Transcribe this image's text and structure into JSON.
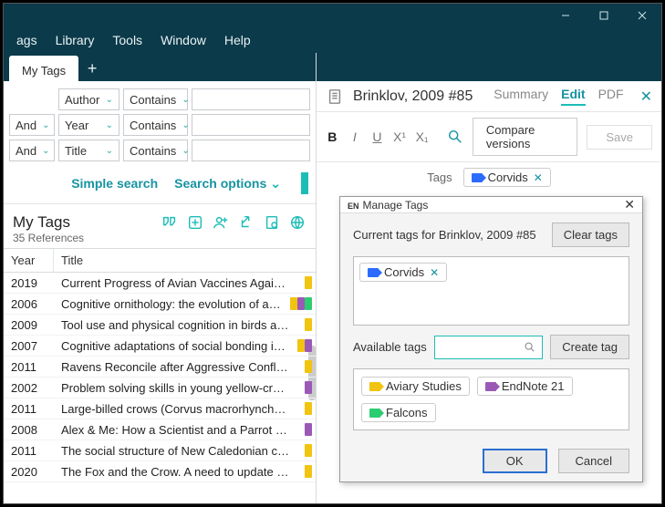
{
  "menubar": {
    "items": [
      "ags",
      "Library",
      "Tools",
      "Window",
      "Help"
    ]
  },
  "tabs": {
    "active": "My Tags"
  },
  "filters": {
    "rows": [
      {
        "op": null,
        "field": "Author",
        "cond": "Contains"
      },
      {
        "op": "And",
        "field": "Year",
        "cond": "Contains"
      },
      {
        "op": "And",
        "field": "Title",
        "cond": "Contains"
      }
    ],
    "simple": "Simple search",
    "options": "Search options"
  },
  "group": {
    "title": "My Tags",
    "subtitle": "35 References"
  },
  "columns": {
    "year": "Year",
    "title": "Title"
  },
  "rows": [
    {
      "year": "2019",
      "title": "Current Progress of Avian Vaccines Against …",
      "tags": [
        "#f1c40f"
      ]
    },
    {
      "year": "2006",
      "title": "Cognitive ornithology: the evolution of a…",
      "tags": [
        "#f1c40f",
        "#9b59b6",
        "#2ecc71"
      ]
    },
    {
      "year": "2009",
      "title": "Tool use and physical cognition in birds and…",
      "tags": [
        "#f1c40f"
      ]
    },
    {
      "year": "2007",
      "title": "Cognitive adaptations of social bonding i…",
      "tags": [
        "#f1c40f",
        "#9b59b6"
      ]
    },
    {
      "year": "2011",
      "title": "Ravens Reconcile after Aggressive Conflicts …",
      "tags": [
        "#f1c40f"
      ]
    },
    {
      "year": "2002",
      "title": "Problem solving skills in young yellow-crow…",
      "tags": [
        "#9b59b6"
      ]
    },
    {
      "year": "2011",
      "title": "Large-billed crows (Corvus macrorhynchos) …",
      "tags": [
        "#f1c40f"
      ]
    },
    {
      "year": "2008",
      "title": "Alex & Me: How a Scientist and a Parrot Dis…",
      "tags": [
        "#9b59b6"
      ]
    },
    {
      "year": "2011",
      "title": "The social structure of New Caledonian crows",
      "tags": [
        "#f1c40f"
      ]
    },
    {
      "year": "2020",
      "title": "The Fox and the Crow. A need to update pe…",
      "tags": [
        "#f1c40f"
      ]
    }
  ],
  "reference": {
    "title": "Brinklov, 2009 #85",
    "subtabs": [
      "Summary",
      "Edit",
      "PDF"
    ],
    "active_subtab": "Edit",
    "format_buttons": {
      "bold": "B",
      "italic": "I",
      "underline": "U",
      "super": "X¹",
      "sub": "X₁"
    },
    "compare": "Compare versions",
    "save": "Save",
    "tags_label": "Tags",
    "current_tag": "Corvids",
    "manage_btn": "Manage tags"
  },
  "dialog": {
    "title": "Manage Tags",
    "current_label": "Current tags for Brinklov, 2009 #85",
    "clear": "Clear tags",
    "current_tags": [
      {
        "label": "Corvids",
        "color": "blue"
      }
    ],
    "available_label": "Available tags",
    "create": "Create tag",
    "available_tags": [
      {
        "label": "Aviary Studies",
        "color": "yellow"
      },
      {
        "label": "EndNote 21",
        "color": "purple"
      },
      {
        "label": "Falcons",
        "color": "green"
      }
    ],
    "ok": "OK",
    "cancel": "Cancel"
  }
}
